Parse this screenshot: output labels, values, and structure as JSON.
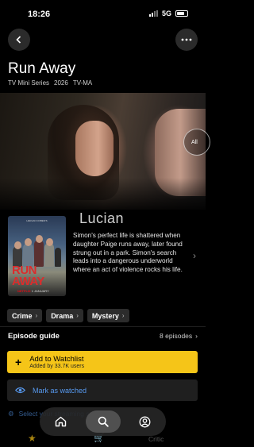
{
  "status_bar": {
    "time": "18:26",
    "network": "5G"
  },
  "header": {
    "back_label": "back",
    "more_label": "more options"
  },
  "show": {
    "title": "Run Away",
    "type": "TV Mini Series",
    "year": "2026",
    "rating": "TV-MA"
  },
  "hero": {
    "all_label": "All"
  },
  "watermark": "Lucian",
  "poster": {
    "top_text": "HARLAN COBEN'S",
    "title_line1": "RUN",
    "title_line2": "AWAY",
    "network_brand": "NETFLIX",
    "network_text": "1 JANUARY"
  },
  "description": "Simon's perfect life is shattered when daughter Paige runs away, later found strung out in a park. Simon's search leads into a dangerous underworld where an act of violence rocks his life.",
  "genres": [
    "Crime",
    "Drama",
    "Mystery"
  ],
  "episode_guide": {
    "label": "Episode guide",
    "count": "8 episodes"
  },
  "watchlist": {
    "label": "Add to Watchlist",
    "sub": "Added by 33.7K users"
  },
  "watched": {
    "label": "Mark as watched"
  },
  "faded_row": {
    "label": "Select your streaming services"
  },
  "bottom_row": {
    "critic_label": "Critic"
  },
  "tabs": [
    "home",
    "search",
    "profile"
  ],
  "colors": {
    "accent": "#f5c518",
    "link": "#5799ef",
    "background": "#000000"
  }
}
